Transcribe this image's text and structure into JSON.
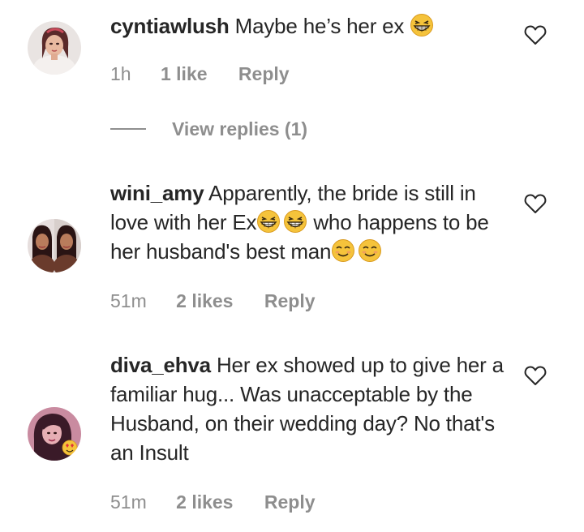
{
  "comments": [
    {
      "username": "cyntiawlush",
      "text": "Maybe he’s her ex",
      "time": "1h",
      "likes": "1 like",
      "reply": "Reply",
      "view_replies": "View replies (1)"
    },
    {
      "username": "wini_amy",
      "text_part1": "Apparently, the bride is still in love with her Ex",
      "text_part2": " who happens to be her husband's best man",
      "time": "51m",
      "likes": "2 likes",
      "reply": "Reply"
    },
    {
      "username": "diva_ehva",
      "text": "Her ex showed up to give her a familiar hug... Was unacceptable by the Husband, on their wedding day? No that's an Insult",
      "time": "51m",
      "likes": "2 likes",
      "reply": "Reply"
    }
  ],
  "icons": {
    "heart": "heart-outline-icon",
    "laugh_emoji": "grinning-squinting-face",
    "smirk_emoji": "smiling-face-with-smiling-eyes"
  },
  "colors": {
    "text": "#262626",
    "secondary": "#8e8e8e",
    "emoji_yellow": "#f5c33b"
  }
}
